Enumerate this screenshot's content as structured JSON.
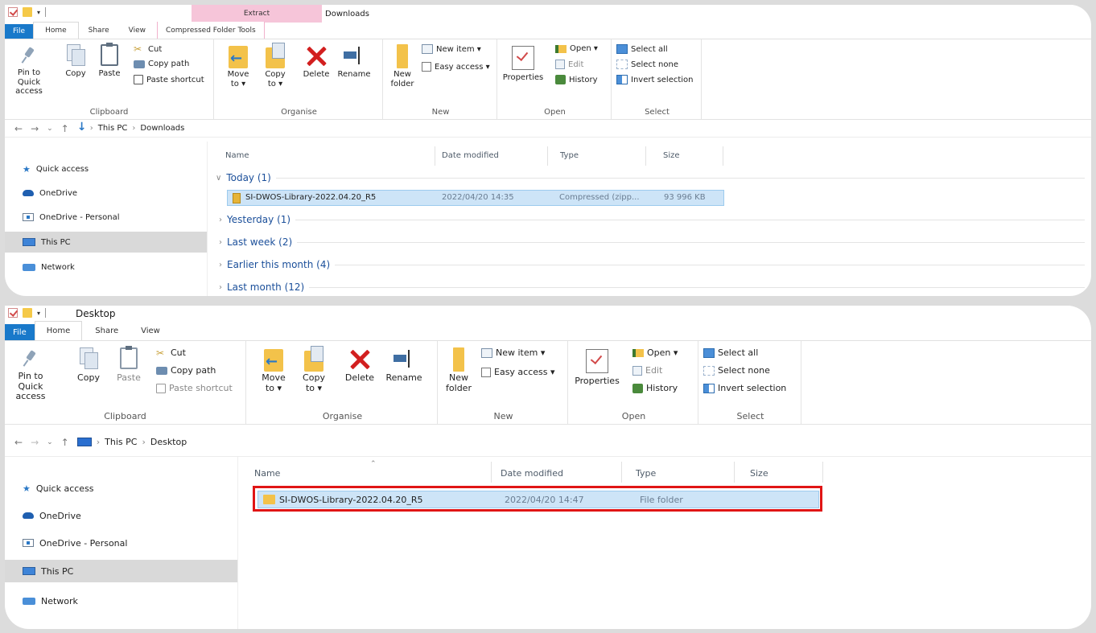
{
  "window1": {
    "title_context_tab": "Extract",
    "title_text": "Downloads",
    "context_group_label": "Compressed Folder Tools",
    "tabs": [
      "File",
      "Home",
      "Share",
      "View"
    ],
    "ribbon": {
      "clipboard": {
        "pin": "Pin to Quick access",
        "copy": "Copy",
        "paste": "Paste",
        "cut": "Cut",
        "copy_path": "Copy path",
        "paste_shortcut": "Paste shortcut",
        "label": "Clipboard"
      },
      "organise": {
        "move_to": "Move to ▾",
        "copy_to": "Copy to ▾",
        "delete": "Delete",
        "rename": "Rename",
        "label": "Organise"
      },
      "new": {
        "new_folder": "New folder",
        "new_item": "New item ▾",
        "easy_access": "Easy access ▾",
        "label": "New"
      },
      "open": {
        "properties": "Properties",
        "open": "Open ▾",
        "edit": "Edit",
        "history": "History",
        "label": "Open"
      },
      "select": {
        "select_all": "Select all",
        "select_none": "Select none",
        "invert_selection": "Invert selection",
        "label": "Select"
      }
    },
    "breadcrumb": [
      "This PC",
      "Downloads"
    ],
    "nav": [
      "Quick access",
      "OneDrive",
      "OneDrive - Personal",
      "This PC",
      "Network"
    ],
    "columns": [
      "Name",
      "Date modified",
      "Type",
      "Size"
    ],
    "groups": [
      "Today (1)",
      "Yesterday (1)",
      "Last week (2)",
      "Earlier this month (4)",
      "Last month (12)"
    ],
    "file": {
      "name": "SI-DWOS-Library-2022.04.20_R5",
      "date": "2022/04/20 14:35",
      "type": "Compressed (zipp...",
      "size": "93 996 KB"
    }
  },
  "window2": {
    "title_text": "Desktop",
    "tabs": [
      "File",
      "Home",
      "Share",
      "View"
    ],
    "ribbon": {
      "clipboard": {
        "pin": "Pin to Quick access",
        "copy": "Copy",
        "paste": "Paste",
        "cut": "Cut",
        "copy_path": "Copy path",
        "paste_shortcut": "Paste shortcut",
        "label": "Clipboard"
      },
      "organise": {
        "move_to": "Move to ▾",
        "copy_to": "Copy to ▾",
        "delete": "Delete",
        "rename": "Rename",
        "label": "Organise"
      },
      "new": {
        "new_folder": "New folder",
        "new_item": "New item ▾",
        "easy_access": "Easy access ▾",
        "label": "New"
      },
      "open": {
        "properties": "Properties",
        "open": "Open ▾",
        "edit": "Edit",
        "history": "History",
        "label": "Open"
      },
      "select": {
        "select_all": "Select all",
        "select_none": "Select none",
        "invert_selection": "Invert selection",
        "label": "Select"
      }
    },
    "breadcrumb": [
      "This PC",
      "Desktop"
    ],
    "nav": [
      "Quick access",
      "OneDrive",
      "OneDrive - Personal",
      "This PC",
      "Network"
    ],
    "columns": [
      "Name",
      "Date modified",
      "Type",
      "Size"
    ],
    "file": {
      "name": "SI-DWOS-Library-2022.04.20_R5",
      "date": "2022/04/20 14:47",
      "type": "File folder"
    }
  },
  "colors": {
    "file_tab": "#1979ca",
    "context_tab": "#f6c5d9",
    "selection": "#cde4f7",
    "highlight_box": "#e01515"
  }
}
